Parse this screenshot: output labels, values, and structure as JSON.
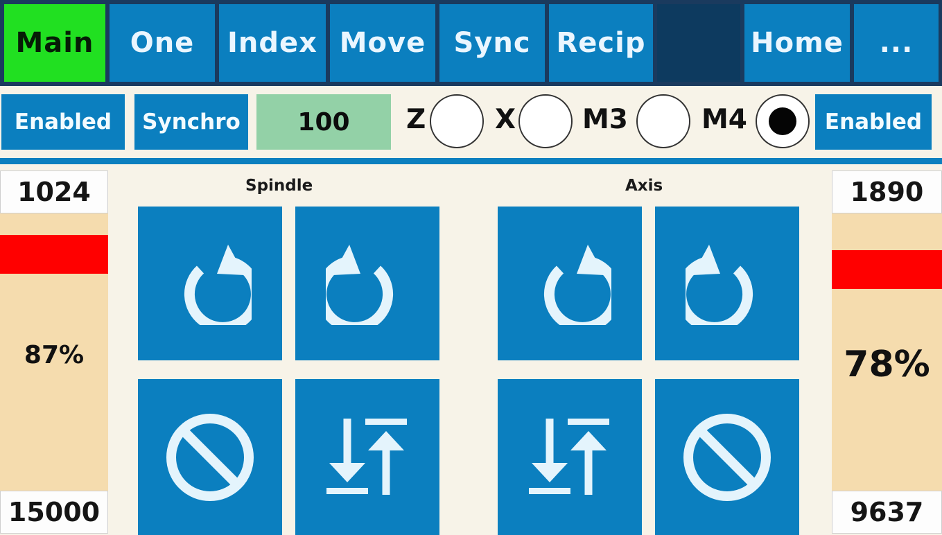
{
  "tabs": [
    {
      "label": "Main",
      "active": true
    },
    {
      "label": "One"
    },
    {
      "label": "Index"
    },
    {
      "label": "Move"
    },
    {
      "label": "Sync"
    },
    {
      "label": "Recip"
    },
    {
      "label": ""
    },
    {
      "label": "Home"
    },
    {
      "label": "..."
    }
  ],
  "controls": {
    "left_enabled": "Enabled",
    "synchro": "Synchro",
    "value": "100",
    "radios": [
      {
        "label": "Z",
        "selected": false
      },
      {
        "label": "X",
        "selected": false
      },
      {
        "label": "M3",
        "selected": false
      },
      {
        "label": "M4",
        "selected": true
      }
    ],
    "right_enabled": "Enabled"
  },
  "left_panel": {
    "top_value": "1024",
    "percent": "87%",
    "percent_value": 0.87,
    "bottom_value": "15000"
  },
  "right_panel": {
    "top_value": "1890",
    "percent": "78%",
    "percent_value": 0.78,
    "bottom_value": "9637"
  },
  "sections": {
    "spindle": "Spindle",
    "axis": "Axis"
  },
  "icons": {
    "ccw": "rotate-ccw-icon",
    "cw": "rotate-cw-icon",
    "stop": "stop-icon",
    "sync": "sync-arrows-icon"
  },
  "colors": {
    "accent": "#0b7fbf",
    "active_tab": "#21e021",
    "gauge_bg": "#f5dcae",
    "gauge_bar": "#ff0000",
    "numbox": "#93d1a7"
  }
}
